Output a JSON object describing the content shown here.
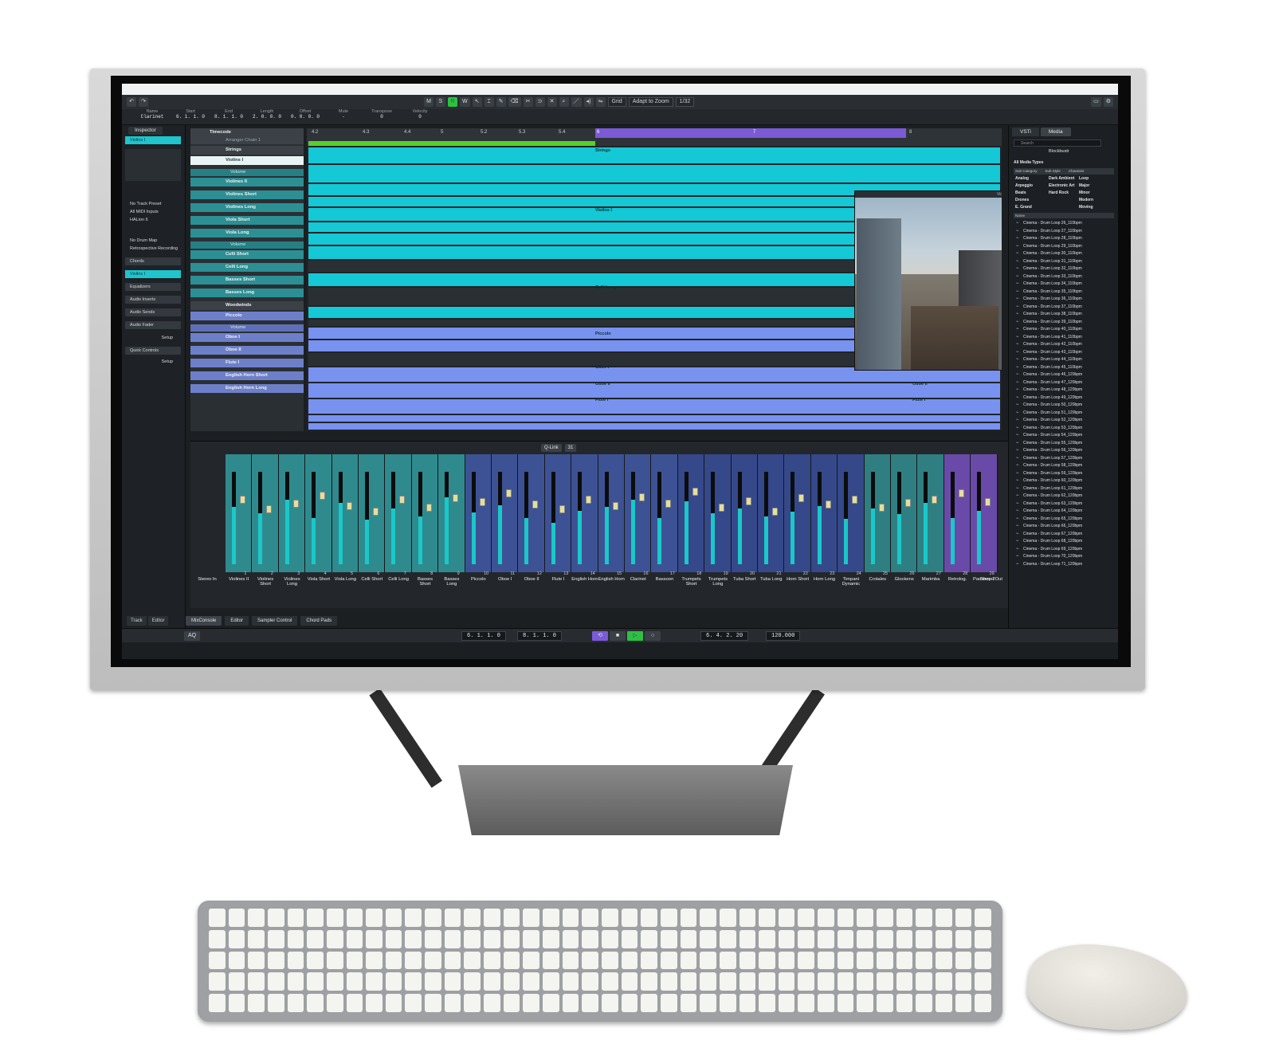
{
  "toolbar": {
    "buttons": [
      "M",
      "S",
      "R",
      "W"
    ],
    "grid_label": "Grid",
    "zoom_label": "Adapt to Zoom",
    "quantize": "1/32"
  },
  "infoline": [
    {
      "label": "Name",
      "value": "Clarinet"
    },
    {
      "label": "Start",
      "value": "6. 1. 1.   0"
    },
    {
      "label": "End",
      "value": "8. 1. 1.   0"
    },
    {
      "label": "Length",
      "value": "2. 0. 0.   0"
    },
    {
      "label": "Offset",
      "value": "0. 0. 0.   0"
    },
    {
      "label": "Mute",
      "value": "-"
    },
    {
      "label": "Transpose",
      "value": "0"
    },
    {
      "label": "Velocity",
      "value": "0"
    }
  ],
  "inspector": {
    "tab": "Inspector",
    "selected_track": "Violins I",
    "rows": [
      "No Track Preset",
      "All MIDI Inputs",
      "HALion 6",
      "No Drum Map",
      "Retrospective Recording"
    ],
    "sections": [
      "Chords",
      "Violins I",
      "Equalizers",
      "Audio Inserts",
      "Audio Sends",
      "Audio Fader",
      "Quick Controls"
    ],
    "setup": "Setup",
    "bottom_tabs": [
      "Track",
      "Editor"
    ]
  },
  "tracklist": {
    "header": "Timecode",
    "arranger": "Arranger Chain 1",
    "tracks": [
      {
        "name": "Strings",
        "kind": "fold"
      },
      {
        "name": "Violins I",
        "kind": "inst"
      },
      {
        "name": "Volume",
        "kind": "auto"
      },
      {
        "name": "Violines II",
        "kind": "inst"
      },
      {
        "name": "Violines Short",
        "kind": "inst"
      },
      {
        "name": "Violines Long",
        "kind": "inst"
      },
      {
        "name": "Viola Short",
        "kind": "inst"
      },
      {
        "name": "Viola Long",
        "kind": "inst"
      },
      {
        "name": "Volume",
        "kind": "auto"
      },
      {
        "name": "Celli Short",
        "kind": "inst"
      },
      {
        "name": "Celli Long",
        "kind": "inst"
      },
      {
        "name": "Basses Short",
        "kind": "inst"
      },
      {
        "name": "Basses Long",
        "kind": "inst"
      },
      {
        "name": "Woodwinds",
        "kind": "fold"
      },
      {
        "name": "Piccolo",
        "kind": "wood"
      },
      {
        "name": "Volume",
        "kind": "auto"
      },
      {
        "name": "Oboe I",
        "kind": "wood"
      },
      {
        "name": "Oboe II",
        "kind": "wood"
      },
      {
        "name": "Flute I",
        "kind": "wood"
      },
      {
        "name": "English Horn Short",
        "kind": "wood"
      },
      {
        "name": "English Horn Long",
        "kind": "wood"
      }
    ]
  },
  "arrange": {
    "parts": [
      "Strings",
      "Violins I",
      "Celli Long",
      "Piccolo",
      "Piccolo",
      "Oboe I",
      "Oboe I",
      "Oboe II",
      "Oboe II",
      "Flute I",
      "Flute I"
    ],
    "video_title": "Video Player"
  },
  "mediabay": {
    "tabs": [
      "VSTi",
      "Media"
    ],
    "search_placeholder": "Search",
    "path": "Blockbustr",
    "filter": "All Media Types",
    "columns": [
      "Sub Category",
      "Sub Style",
      "Character"
    ],
    "categories": [
      "Analog",
      "Arpeggio",
      "Beats",
      "Drones",
      "E. Grand",
      "Dark Ambient",
      "Electronic Art",
      "Hard Rock",
      "Loop",
      "Major",
      "Minor",
      "Modern",
      "Moving"
    ],
    "name_header": "Name",
    "results": [
      "Cinema - Drum Loop 26_110bpm",
      "Cinema - Drum Loop 27_110bpm",
      "Cinema - Drum Loop 28_110bpm",
      "Cinema - Drum Loop 29_110bpm",
      "Cinema - Drum Loop 30_110bpm",
      "Cinema - Drum Loop 31_110bpm",
      "Cinema - Drum Loop 32_110bpm",
      "Cinema - Drum Loop 33_110bpm",
      "Cinema - Drum Loop 34_110bpm",
      "Cinema - Drum Loop 35_110bpm",
      "Cinema - Drum Loop 36_110bpm",
      "Cinema - Drum Loop 37_110bpm",
      "Cinema - Drum Loop 38_110bpm",
      "Cinema - Drum Loop 39_110bpm",
      "Cinema - Drum Loop 40_110bpm",
      "Cinema - Drum Loop 41_110bpm",
      "Cinema - Drum Loop 42_110bpm",
      "Cinema - Drum Loop 43_110bpm",
      "Cinema - Drum Loop 44_110bpm",
      "Cinema - Drum Loop 45_110bpm",
      "Cinema - Drum Loop 46_120bpm",
      "Cinema - Drum Loop 47_120bpm",
      "Cinema - Drum Loop 48_120bpm",
      "Cinema - Drum Loop 49_120bpm",
      "Cinema - Drum Loop 50_120bpm",
      "Cinema - Drum Loop 51_120bpm",
      "Cinema - Drum Loop 52_120bpm",
      "Cinema - Drum Loop 53_120bpm",
      "Cinema - Drum Loop 54_120bpm",
      "Cinema - Drum Loop 55_120bpm",
      "Cinema - Drum Loop 56_120bpm",
      "Cinema - Drum Loop 57_120bpm",
      "Cinema - Drum Loop 58_120bpm",
      "Cinema - Drum Loop 59_120bpm",
      "Cinema - Drum Loop 60_120bpm",
      "Cinema - Drum Loop 61_120bpm",
      "Cinema - Drum Loop 62_120bpm",
      "Cinema - Drum Loop 63_120bpm",
      "Cinema - Drum Loop 64_120bpm",
      "Cinema - Drum Loop 65_120bpm",
      "Cinema - Drum Loop 66_120bpm",
      "Cinema - Drum Loop 67_120bpm",
      "Cinema - Drum Loop 68_120bpm",
      "Cinema - Drum Loop 69_120bpm",
      "Cinema - Drum Loop 70_120bpm",
      "Cinema - Drum Loop 71_120bpm"
    ]
  },
  "mixconsole": {
    "qlink": "Q-Link",
    "channel_count": "31",
    "input": "Stereo In",
    "output": "Stereo Out",
    "channels": [
      {
        "num": "1",
        "name": "Violines II"
      },
      {
        "num": "2",
        "name": "Violines Short"
      },
      {
        "num": "3",
        "name": "Violines Long"
      },
      {
        "num": "4",
        "name": "Viola Short"
      },
      {
        "num": "5",
        "name": "Viola Long"
      },
      {
        "num": "6",
        "name": "Celli Short"
      },
      {
        "num": "7",
        "name": "Celli Long"
      },
      {
        "num": "8",
        "name": "Basses Short"
      },
      {
        "num": "9",
        "name": "Basses Long"
      },
      {
        "num": "10",
        "name": "Piccolo"
      },
      {
        "num": "11",
        "name": "Oboe I"
      },
      {
        "num": "12",
        "name": "Oboe II"
      },
      {
        "num": "13",
        "name": "Flute I"
      },
      {
        "num": "14",
        "name": "English Horn"
      },
      {
        "num": "15",
        "name": "English Horn"
      },
      {
        "num": "16",
        "name": "Clarinet"
      },
      {
        "num": "17",
        "name": "Bassoon"
      },
      {
        "num": "18",
        "name": "Trumpets Short"
      },
      {
        "num": "19",
        "name": "Trumpets Long"
      },
      {
        "num": "20",
        "name": "Tuba Short"
      },
      {
        "num": "21",
        "name": "Tuba Long"
      },
      {
        "num": "22",
        "name": "Horn Short"
      },
      {
        "num": "23",
        "name": "Horn Long"
      },
      {
        "num": "24",
        "name": "Timpani Dynamic"
      },
      {
        "num": "25",
        "name": "Crotales"
      },
      {
        "num": "26",
        "name": "Glockens"
      },
      {
        "num": "27",
        "name": "Marimba"
      },
      {
        "num": "28",
        "name": "Retrolog."
      },
      {
        "num": "29",
        "name": "Padshop 2"
      }
    ],
    "bottom_tabs": [
      "MixConsole",
      "Editor",
      "Sampler Control",
      "Chord Pads"
    ]
  },
  "transport": {
    "left_locator": "6. 1. 1.   0",
    "right_locator": "8. 1. 1.   0",
    "position": "6. 4. 2. 20",
    "tempo": "120.000",
    "aq": "AQ"
  },
  "colors": {
    "instrument_tracks": "#14c8d6",
    "woodwind_tracks": "#7892f0",
    "selection": "#7b5ad6",
    "fader_cap": "#e5df9a"
  }
}
